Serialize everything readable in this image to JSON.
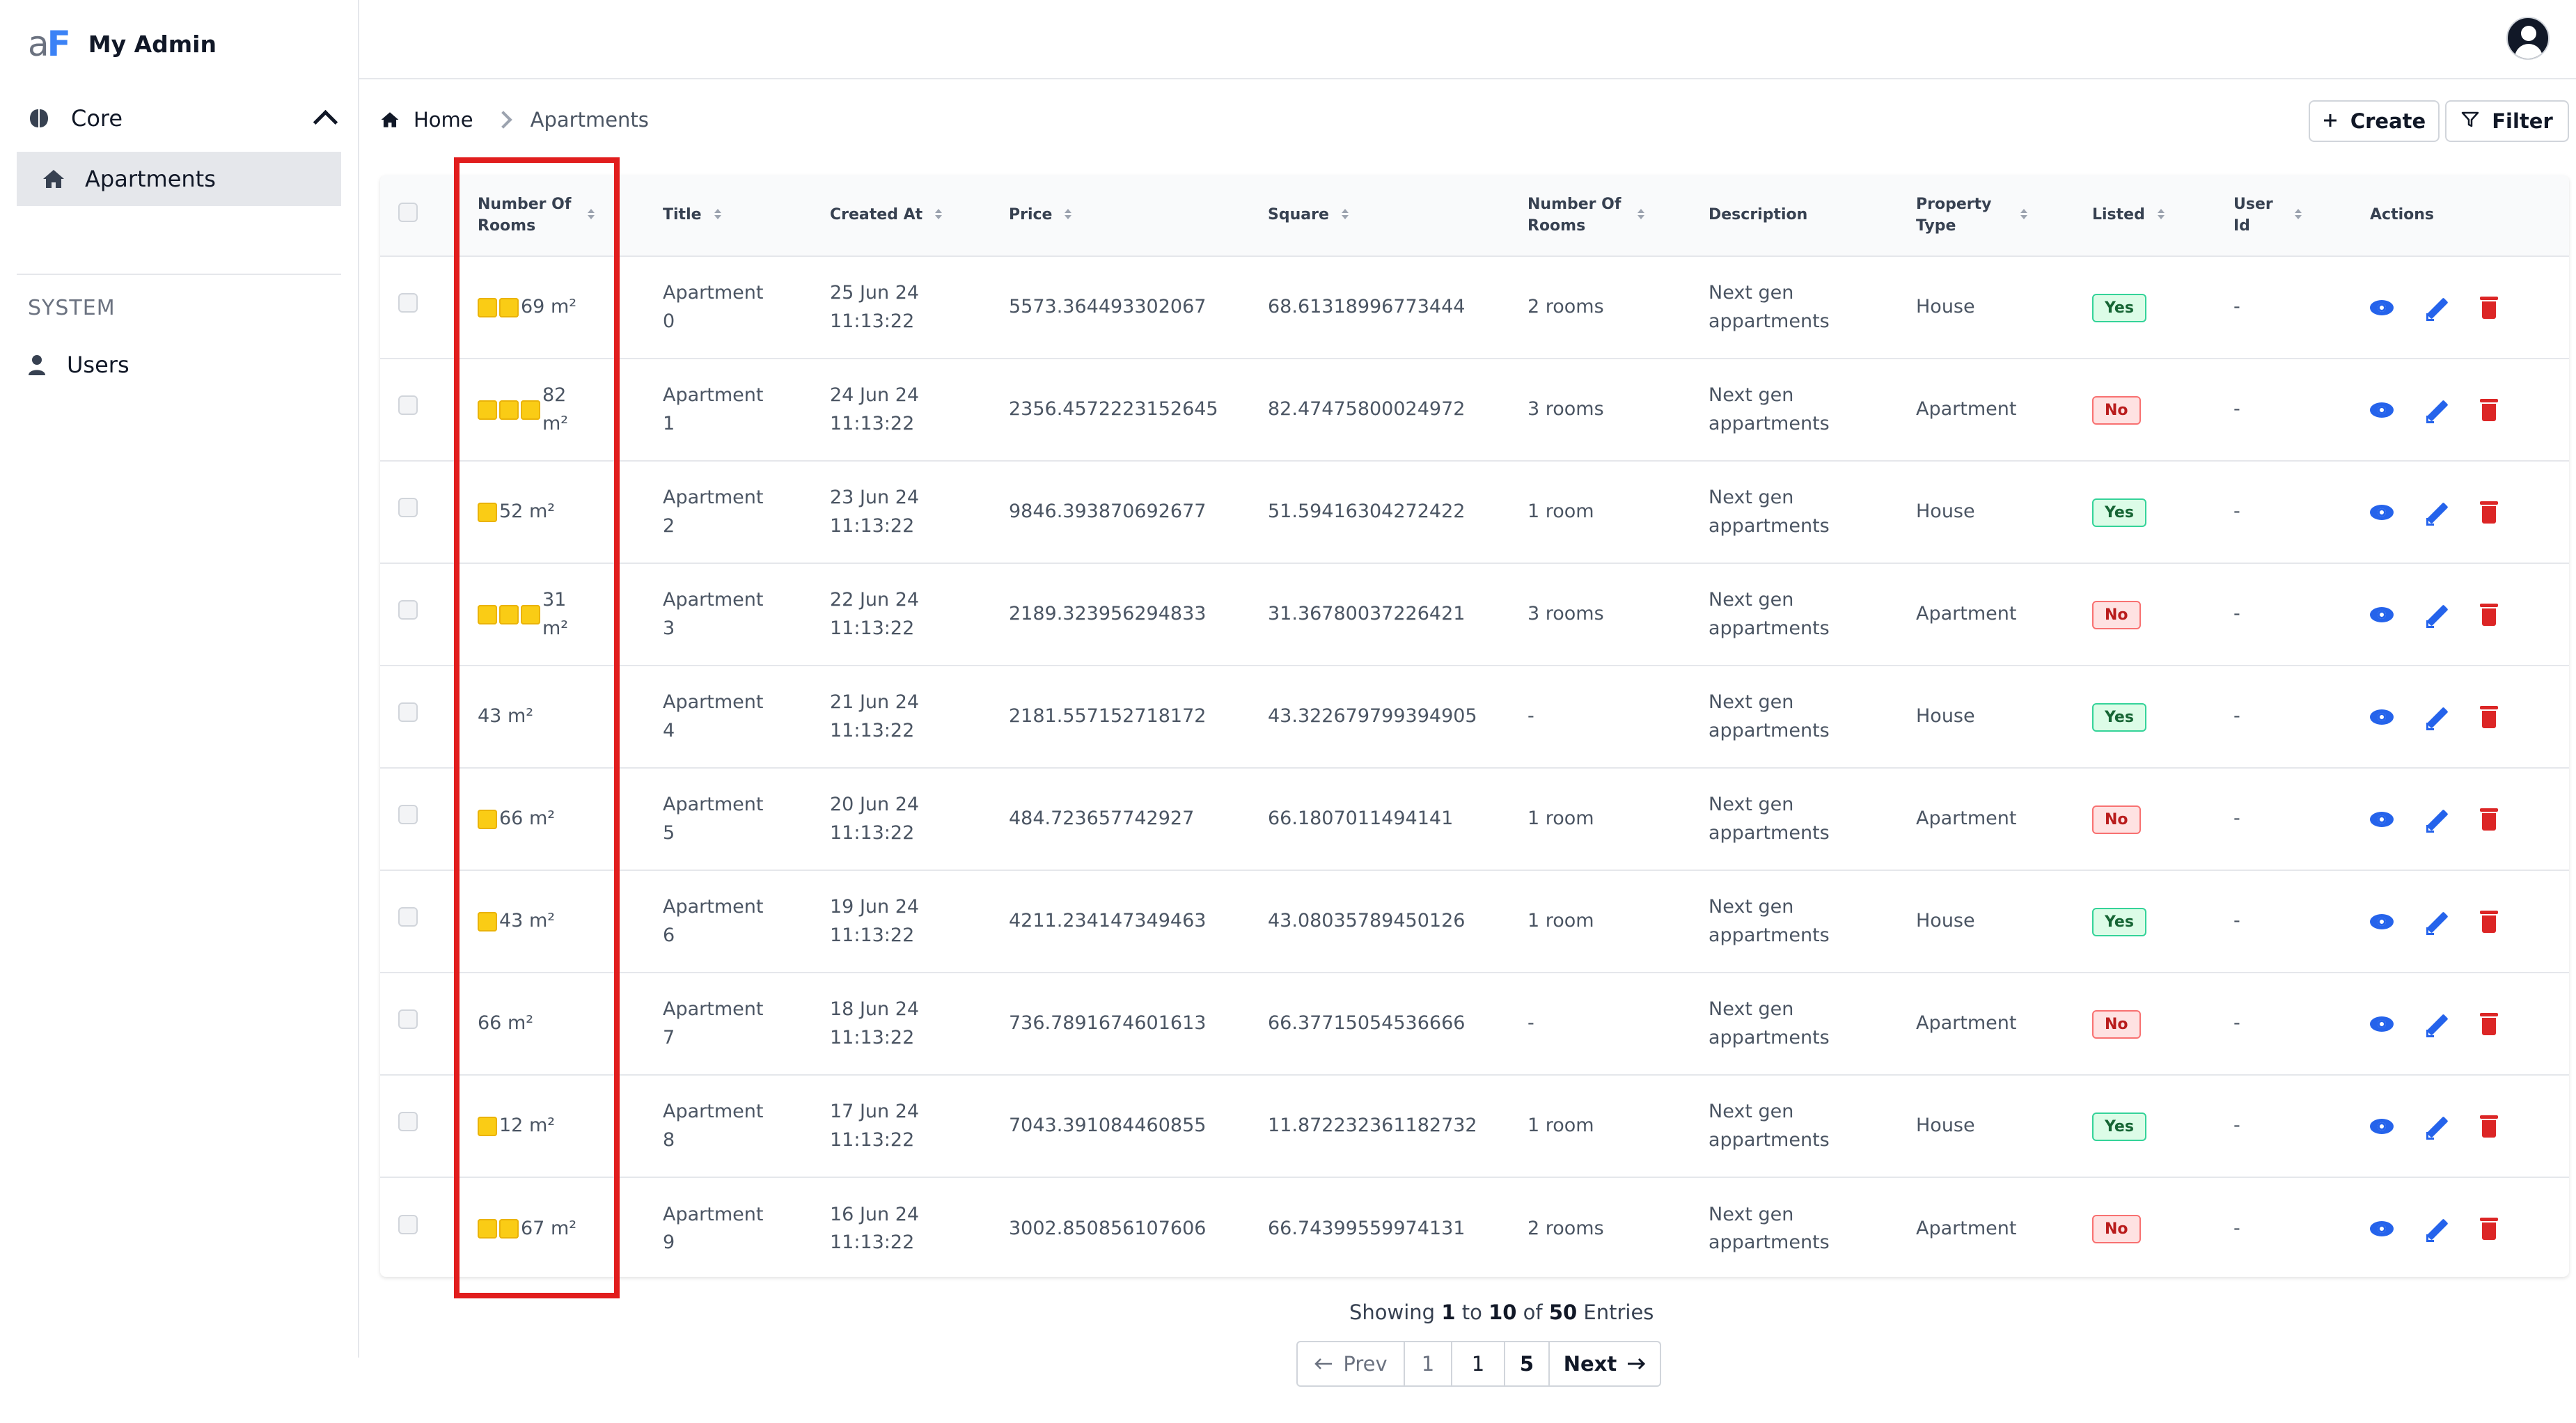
{
  "app": {
    "name": "My Admin",
    "logo_text": "aF"
  },
  "sidebar": {
    "core_label": "Core",
    "active_item": "Apartments",
    "system_label": "SYSTEM",
    "users_label": "Users"
  },
  "breadcrumb": {
    "home": "Home",
    "current": "Apartments"
  },
  "toolbar": {
    "create_label": "Create",
    "filter_label": "Filter"
  },
  "table": {
    "headers": {
      "number_of_rooms_a": "Number Of Rooms",
      "title": "Title",
      "created_at": "Created At",
      "price": "Price",
      "square": "Square",
      "number_of_rooms_b": "Number Of Rooms",
      "description": "Description",
      "property_type": "Property Type",
      "listed": "Listed",
      "user_id": "User Id",
      "actions": "Actions"
    },
    "rows": [
      {
        "squares": 2,
        "area": "69 m²",
        "title": "Apartment 0",
        "created": "25 Jun 24 11:13:22",
        "price": "5573.364493302067",
        "square": "68.61318996773444",
        "rooms": "2 rooms",
        "description": "Next gen appartments",
        "type": "House",
        "listed": "Yes",
        "user_id": "-"
      },
      {
        "squares": 3,
        "area": "82 m²",
        "title": "Apartment 1",
        "created": "24 Jun 24 11:13:22",
        "price": "2356.4572223152645",
        "square": "82.47475800024972",
        "rooms": "3 rooms",
        "description": "Next gen appartments",
        "type": "Apartment",
        "listed": "No",
        "user_id": "-"
      },
      {
        "squares": 1,
        "area": "52 m²",
        "title": "Apartment 2",
        "created": "23 Jun 24 11:13:22",
        "price": "9846.393870692677",
        "square": "51.59416304272422",
        "rooms": "1 room",
        "description": "Next gen appartments",
        "type": "House",
        "listed": "Yes",
        "user_id": "-"
      },
      {
        "squares": 3,
        "area": "31 m²",
        "title": "Apartment 3",
        "created": "22 Jun 24 11:13:22",
        "price": "2189.323956294833",
        "square": "31.36780037226421",
        "rooms": "3 rooms",
        "description": "Next gen appartments",
        "type": "Apartment",
        "listed": "No",
        "user_id": "-"
      },
      {
        "squares": 0,
        "area": "43 m²",
        "title": "Apartment 4",
        "created": "21 Jun 24 11:13:22",
        "price": "2181.557152718172",
        "square": "43.322679799394905",
        "rooms": "-",
        "description": "Next gen appartments",
        "type": "House",
        "listed": "Yes",
        "user_id": "-"
      },
      {
        "squares": 1,
        "area": "66 m²",
        "title": "Apartment 5",
        "created": "20 Jun 24 11:13:22",
        "price": "484.723657742927",
        "square": "66.1807011494141",
        "rooms": "1 room",
        "description": "Next gen appartments",
        "type": "Apartment",
        "listed": "No",
        "user_id": "-"
      },
      {
        "squares": 1,
        "area": "43 m²",
        "title": "Apartment 6",
        "created": "19 Jun 24 11:13:22",
        "price": "4211.234147349463",
        "square": "43.08035789450126",
        "rooms": "1 room",
        "description": "Next gen appartments",
        "type": "House",
        "listed": "Yes",
        "user_id": "-"
      },
      {
        "squares": 0,
        "area": "66 m²",
        "title": "Apartment 7",
        "created": "18 Jun 24 11:13:22",
        "price": "736.7891674601613",
        "square": "66.37715054536666",
        "rooms": "-",
        "description": "Next gen appartments",
        "type": "Apartment",
        "listed": "No",
        "user_id": "-"
      },
      {
        "squares": 1,
        "area": "12 m²",
        "title": "Apartment 8",
        "created": "17 Jun 24 11:13:22",
        "price": "7043.391084460855",
        "square": "11.872232361182732",
        "rooms": "1 room",
        "description": "Next gen appartments",
        "type": "House",
        "listed": "Yes",
        "user_id": "-"
      },
      {
        "squares": 2,
        "area": "67 m²",
        "title": "Apartment 9",
        "created": "16 Jun 24 11:13:22",
        "price": "3002.850856107606",
        "square": "66.74399559974131",
        "rooms": "2 rooms",
        "description": "Next gen appartments",
        "type": "Apartment",
        "listed": "No",
        "user_id": "-"
      }
    ]
  },
  "pagination": {
    "showing_prefix": "Showing",
    "from": "1",
    "to_word": "to",
    "to": "10",
    "of_word": "of",
    "total": "50",
    "entries_word": "Entries",
    "prev_label": "Prev",
    "pages": [
      "1",
      "1",
      "5"
    ],
    "next_label": "Next"
  },
  "colors": {
    "accent": "#2563eb",
    "danger": "#dc2626",
    "highlight": "#e11d1d",
    "room_square": "#facc15"
  },
  "icons": [
    "home-icon",
    "core-brain-icon",
    "chevron-up-icon",
    "user-icon",
    "avatar-icon",
    "plus-icon",
    "filter-icon",
    "sort-icon",
    "eye-icon",
    "pencil-icon",
    "trash-icon",
    "arrow-left-icon",
    "arrow-right-icon"
  ]
}
